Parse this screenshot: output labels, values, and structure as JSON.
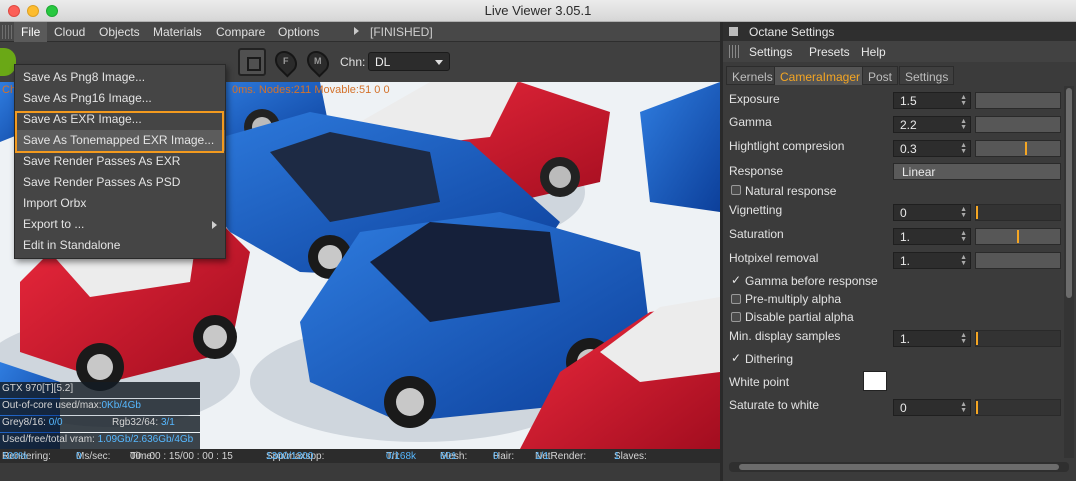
{
  "window": {
    "title": "Live Viewer 3.05.1"
  },
  "menubar": {
    "items": [
      "File",
      "Cloud",
      "Objects",
      "Materials",
      "Compare",
      "Options"
    ],
    "status": "[FINISHED]"
  },
  "toolbar": {
    "chn_label": "Chn:",
    "chn_value": "DL",
    "pin_f": "F",
    "pin_m": "M"
  },
  "file_menu": {
    "items": [
      "Save As Png8 Image...",
      "Save As Png16 Image...",
      "Save As EXR Image...",
      "Save As Tonemapped EXR Image...",
      "Save Render Passes As EXR",
      "Save Render Passes As PSD",
      "Import Orbx",
      "Export to ...",
      "Edit in Standalone"
    ],
    "highlighted_index": 3
  },
  "viewport": {
    "stat_left": "Ch",
    "stat_right": "0ms. Nodes:211 Movable:51  0  0"
  },
  "gpu_info": {
    "name": "GTX 970[T][5.2]",
    "ooc_label": "Out-of-core used/max:",
    "ooc_value": "0Kb/4Gb",
    "grey_label": "Grey8/16:",
    "grey_value": "0/0",
    "rgb_label": "Rgb32/64:",
    "rgb_value": "3/1",
    "vram_label": "Used/free/total vram:",
    "vram_value": "1.09Gb/2.636Gb/4Gb"
  },
  "statusbar": {
    "rendering_label": "Rendering:",
    "rendering_value": "100%",
    "mss_label": "Ms/sec:",
    "mss_value": "0",
    "time_label": "Time:",
    "time_value": "00 : 00 : 15/00 : 00 : 15",
    "spp_label": "Spp/maxspp:",
    "spp_value": "1300/1300",
    "tri_label": "Tri:",
    "tri_value": "0/168k",
    "mesh_label": "Mesh:",
    "mesh_value": "601",
    "hair_label": "Hair:",
    "hair_value": "0",
    "net_label": "NetRender:",
    "net_value": "1/1",
    "slaves_label": "Slaves:",
    "slaves_value": "1"
  },
  "settings_panel": {
    "title": "Octane Settings",
    "menu": [
      "Settings",
      "Presets",
      "Help"
    ],
    "tabs": [
      "Kernels",
      "CameraImager",
      "Post",
      "Settings"
    ],
    "active_tab": "CameraImager",
    "exposure": {
      "label": "Exposure",
      "value": "1.5"
    },
    "gamma": {
      "label": "Gamma",
      "value": "2.2"
    },
    "highlight": {
      "label": "Hightlight compresion",
      "value": "0.3",
      "level": 0.6
    },
    "response": {
      "label": "Response",
      "value": "Linear"
    },
    "natural_response": {
      "label": "Natural response",
      "checked": false
    },
    "vignetting": {
      "label": "Vignetting",
      "value": "0",
      "level": 0.0
    },
    "saturation": {
      "label": "Saturation",
      "value": "1.",
      "level": 0.5
    },
    "hotpixel": {
      "label": "Hotpixel removal",
      "value": "1."
    },
    "gamma_before": {
      "label": "Gamma before response",
      "checked": true
    },
    "premultiply": {
      "label": "Pre-multiply alpha",
      "checked": false
    },
    "partial_alpha": {
      "label": "Disable partial alpha",
      "checked": false
    },
    "min_samples": {
      "label": "Min. display samples",
      "value": "1.",
      "level": 0.0
    },
    "dithering": {
      "label": "Dithering",
      "checked": true
    },
    "white_point": {
      "label": "White point",
      "color": "#ffffff"
    },
    "saturate_white": {
      "label": "Saturate to white",
      "value": "0",
      "level": 0.0
    },
    "check_glyph": "✓"
  },
  "colors": {
    "accent": "#f5a623",
    "highlight_border": "#f39a1e",
    "info_value": "#56b8ff"
  }
}
